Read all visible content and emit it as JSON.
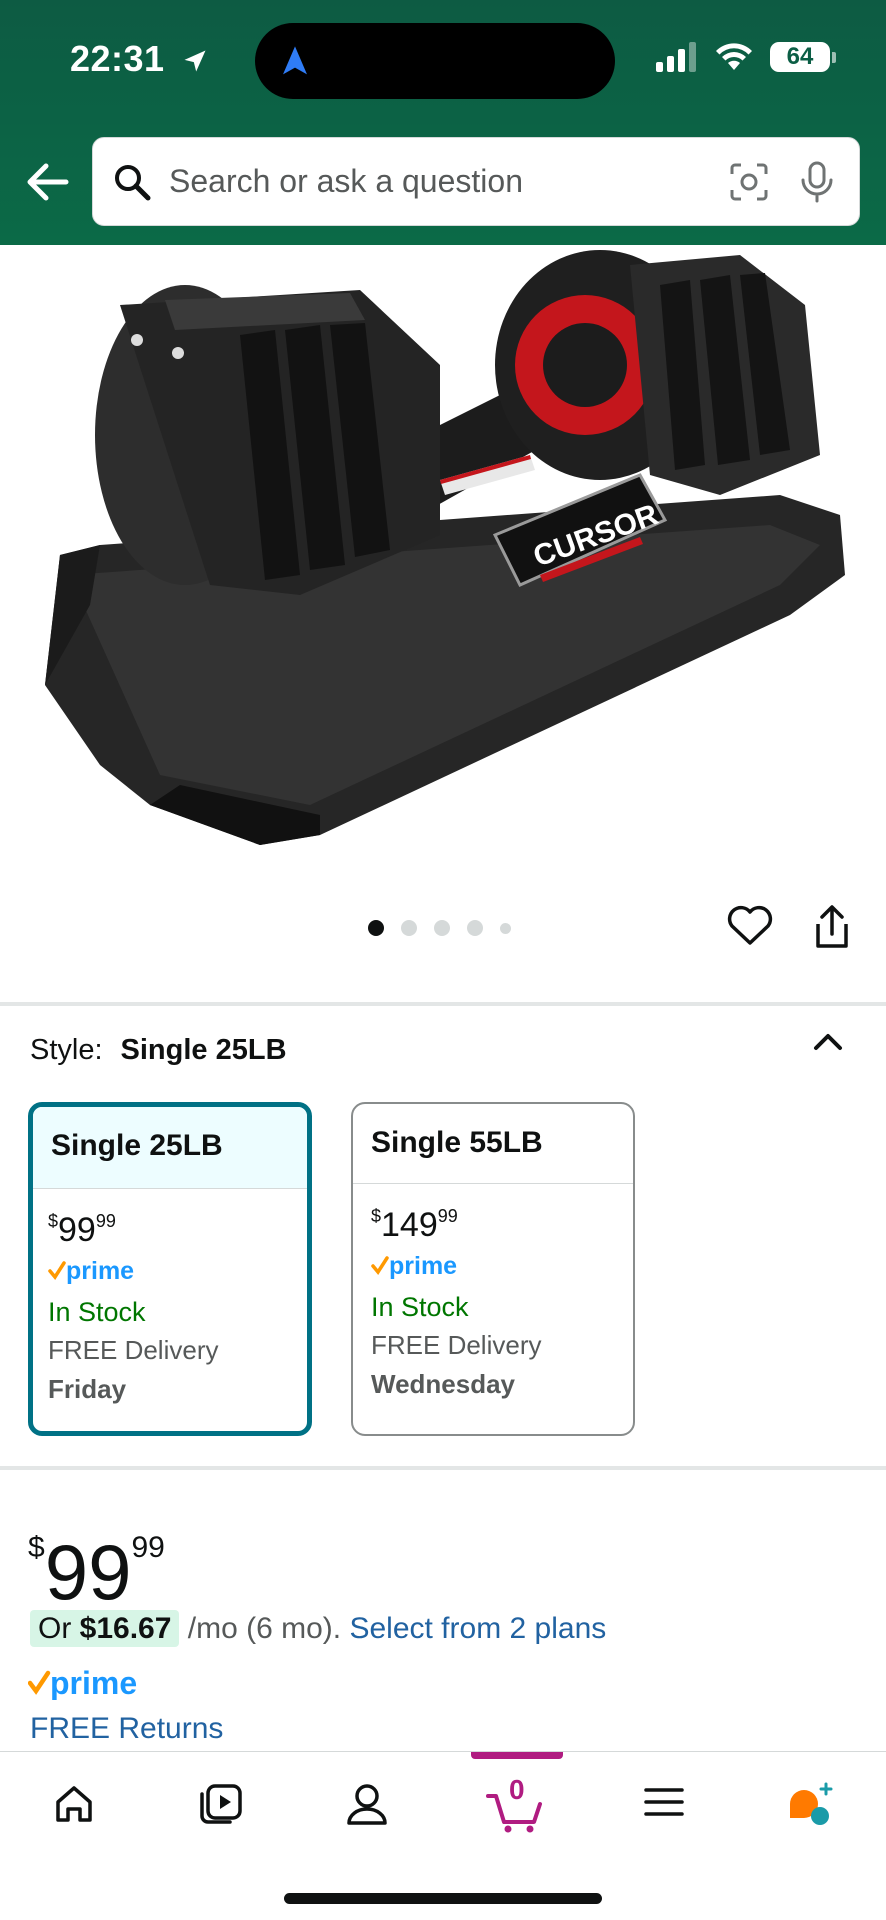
{
  "status_bar": {
    "time": "22:31",
    "battery": "64"
  },
  "search": {
    "placeholder": "Search or ask a question"
  },
  "product": {
    "brand_logo": "CURSOR",
    "image_count": 5,
    "active_image_index": 0
  },
  "style_selector": {
    "label": "Style:",
    "selected": "Single 25LB",
    "options": [
      {
        "name": "Single 25LB",
        "price_whole": "99",
        "price_fraction": "99",
        "currency": "$",
        "prime": "prime",
        "stock": "In Stock",
        "delivery": "FREE Delivery",
        "day": "Friday",
        "selected": true
      },
      {
        "name": "Single 55LB",
        "price_whole": "149",
        "price_fraction": "99",
        "currency": "$",
        "prime": "prime",
        "stock": "In Stock",
        "delivery": "FREE Delivery",
        "day": "Wednesday",
        "selected": false
      }
    ]
  },
  "price": {
    "currency": "$",
    "whole": "99",
    "fraction": "99"
  },
  "financing": {
    "prefix": "Or ",
    "amount": "$16.67",
    "term": " /mo (6 mo). ",
    "link": "Select from 2 plans"
  },
  "prime_label": "prime",
  "returns": "FREE Returns",
  "bottom_nav": {
    "items": [
      "home-icon",
      "video-icon",
      "account-icon",
      "cart-icon",
      "menu-icon",
      "rufus-icon"
    ],
    "cart_count": "0"
  },
  "colors": {
    "header": "#0b6a47",
    "link": "#2162a1",
    "selected": "#007185",
    "stock": "#007600",
    "prime": "#1a98ff",
    "cart": "#b01c81"
  }
}
